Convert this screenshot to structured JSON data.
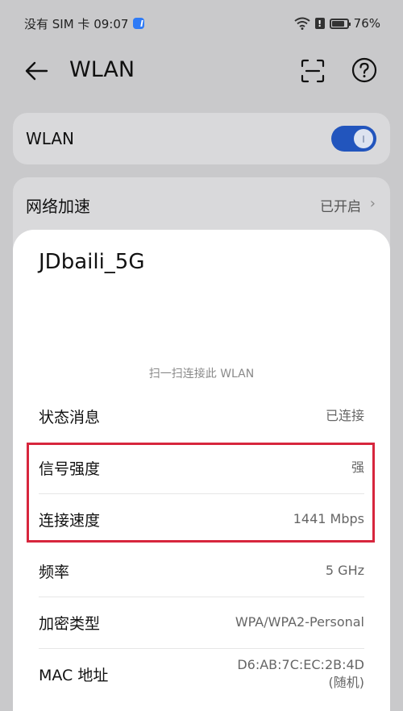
{
  "status_bar": {
    "left_text": "没有 SIM 卡 09:07",
    "battery_percent": "76%",
    "alert_glyph": "!",
    "icons": [
      "app-notification-icon",
      "wifi-icon",
      "alert-icon",
      "battery-icon"
    ]
  },
  "app_bar": {
    "title": "WLAN",
    "icons": [
      "back-arrow-icon",
      "scan-icon",
      "help-icon"
    ]
  },
  "wlan_toggle": {
    "label": "WLAN",
    "enabled": true,
    "accent_color": "#2255bd"
  },
  "network_accel": {
    "label": "网络加速",
    "value": "已开启",
    "chevron": "›"
  },
  "detail_sheet": {
    "ssid": "JDbaili_5G",
    "qr_hint": "扫一扫连接此 WLAN",
    "rows": [
      {
        "label": "状态消息",
        "value": "已连接"
      },
      {
        "label": "信号强度",
        "value": "强"
      },
      {
        "label": "连接速度",
        "value": "1441 Mbps"
      },
      {
        "label": "频率",
        "value": "5 GHz"
      },
      {
        "label": "加密类型",
        "value": "WPA/WPA2-Personal"
      },
      {
        "label": "MAC 地址",
        "value": "D6:AB:7C:EC:2B:4D",
        "value_note": "(随机)"
      }
    ],
    "highlight_color": "#d7263d"
  }
}
